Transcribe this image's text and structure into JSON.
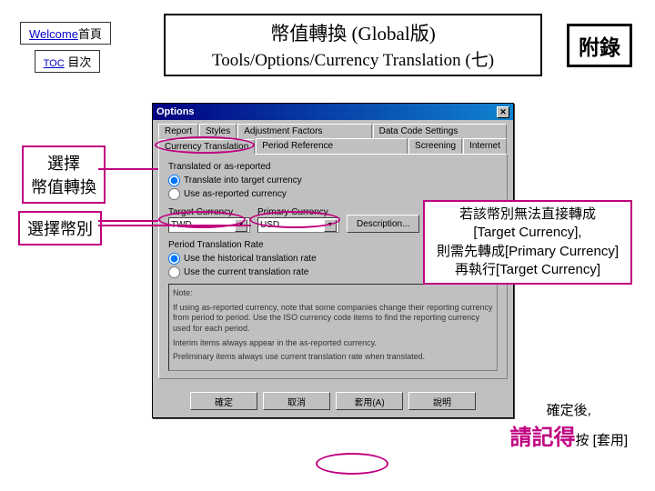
{
  "nav": {
    "welcome_link": "Welcome",
    "welcome_suffix": "首頁",
    "toc_link": "TOC",
    "toc_suffix": "目次"
  },
  "title": {
    "line1": "幣值轉換 (Global版)",
    "line2": "Tools/Options/Currency Translation (七)"
  },
  "appendix": "附錄",
  "callouts": {
    "select_translation": "選擇\n幣值轉換",
    "select_currency": "選擇幣別"
  },
  "note": {
    "l1": "若該幣別無法直接轉成",
    "l2": "[Target Currency],",
    "l3": "則需先轉成[Primary Currency]",
    "l4": "再執行[Target Currency]"
  },
  "confirm": {
    "l1": "確定後,",
    "big": "請記得",
    "l2": "按 [套用]"
  },
  "dialog": {
    "title": "Options",
    "tabs_row1": [
      "Report",
      "Styles",
      "Adjustment Factors",
      "Data Code Settings"
    ],
    "tabs_row2": [
      "Currency Translation",
      "Period Reference",
      "Screening",
      "Internet"
    ],
    "sec1_label": "Translated or as-reported",
    "radio_translate": "Translate into target currency",
    "radio_asreported": "Use as-reported currency",
    "target_label": "Target Currency",
    "target_value": "TWD",
    "primary_label": "Primary Currency",
    "primary_value": "USD",
    "description_btn": "Description...",
    "rate_label": "Period Translation Rate",
    "radio_historical": "Use the historical translation rate",
    "radio_current": "Use the current translation rate",
    "note_heading": "Note:",
    "note_p1": "If using as-reported currency, note that some companies change their reporting currency from period to period. Use the ISO currency code items to find the reporting currency used for each period.",
    "note_p2": "Interim items always appear in the as-reported currency.",
    "note_p3": "Preliminary items always use current translation rate when translated.",
    "btn_ok": "確定",
    "btn_cancel": "取消",
    "btn_apply": "套用(A)",
    "btn_help": "說明"
  }
}
